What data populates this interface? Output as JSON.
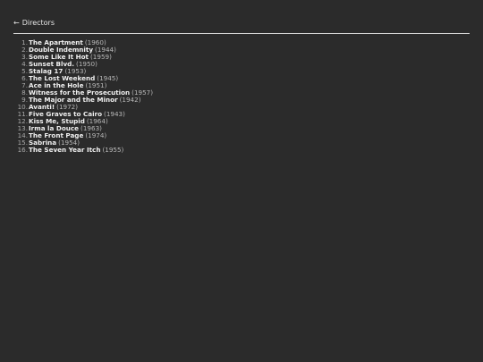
{
  "nav": {
    "back_arrow": "←",
    "back_label": "Directors"
  },
  "films": [
    {
      "num": "1.",
      "title": "The Apartment",
      "year": "(1960)"
    },
    {
      "num": "2.",
      "title": "Double Indemnity",
      "year": "(1944)"
    },
    {
      "num": "3.",
      "title": "Some Like It Hot",
      "year": "(1959)"
    },
    {
      "num": "4.",
      "title": "Sunset Blvd.",
      "year": "(1950)"
    },
    {
      "num": "5.",
      "title": "Stalag 17",
      "year": "(1953)"
    },
    {
      "num": "6.",
      "title": "The Lost Weekend",
      "year": "(1945)"
    },
    {
      "num": "7.",
      "title": "Ace in the Hole",
      "year": "(1951)"
    },
    {
      "num": "8.",
      "title": "Witness for the Prosecution",
      "year": "(1957)"
    },
    {
      "num": "9.",
      "title": "The Major and the Minor",
      "year": "(1942)"
    },
    {
      "num": "10.",
      "title": "Avanti!",
      "year": "(1972)"
    },
    {
      "num": "11.",
      "title": "Five Graves to Cairo",
      "year": "(1943)"
    },
    {
      "num": "12.",
      "title": "Kiss Me, Stupid",
      "year": "(1964)"
    },
    {
      "num": "13.",
      "title": "Irma la Douce",
      "year": "(1963)"
    },
    {
      "num": "14.",
      "title": "The Front Page",
      "year": "(1974)"
    },
    {
      "num": "15.",
      "title": "Sabrina",
      "year": "(1954)"
    },
    {
      "num": "16.",
      "title": "The Seven Year Itch",
      "year": "(1955)"
    }
  ],
  "colors": {
    "background": "#2b2b2b",
    "text": "#f0f0f0",
    "muted": "#a8a8a8",
    "divider": "#d8d8d8"
  }
}
